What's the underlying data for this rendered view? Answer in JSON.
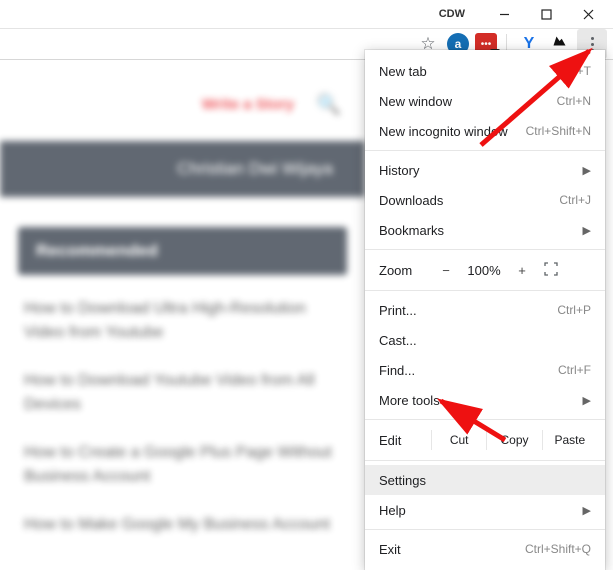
{
  "titlebar": {
    "user_label": "CDW"
  },
  "page": {
    "write_story": "Write a Story",
    "author_name": "Christian Dwi Wijaya",
    "recommended_label": "Recommended",
    "blurred_items": [
      "How to Download Ultra High-Resolution Video from Youtube",
      "How to Download Youtube Video from All Devices",
      "How to Create a Google Plus Page Without Business Account",
      "How to Make Google My Business Account"
    ]
  },
  "menu": {
    "new_tab": {
      "label": "New tab",
      "shortcut": "Ctrl+T"
    },
    "new_window": {
      "label": "New window",
      "shortcut": "Ctrl+N"
    },
    "new_incognito": {
      "label": "New incognito window",
      "shortcut": "Ctrl+Shift+N"
    },
    "history": {
      "label": "History"
    },
    "downloads": {
      "label": "Downloads",
      "shortcut": "Ctrl+J"
    },
    "bookmarks": {
      "label": "Bookmarks"
    },
    "zoom": {
      "label": "Zoom",
      "minus": "−",
      "value": "100%",
      "plus": "+"
    },
    "print": {
      "label": "Print...",
      "shortcut": "Ctrl+P"
    },
    "cast": {
      "label": "Cast..."
    },
    "find": {
      "label": "Find...",
      "shortcut": "Ctrl+F"
    },
    "more_tools": {
      "label": "More tools"
    },
    "edit": {
      "label": "Edit",
      "cut": "Cut",
      "copy": "Copy",
      "paste": "Paste"
    },
    "settings": {
      "label": "Settings"
    },
    "help": {
      "label": "Help"
    },
    "exit": {
      "label": "Exit",
      "shortcut": "Ctrl+Shift+Q"
    }
  }
}
